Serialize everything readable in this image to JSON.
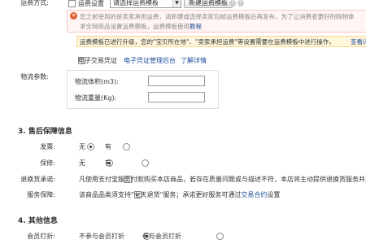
{
  "freight": {
    "method_label": "运费方式:",
    "option_label": "运费设置",
    "select_value": "请选择运费模板",
    "new_button": "新建运费模板",
    "warning_text1": "您之前使用的是卖家承担运费，请新建或选择卖家包邮运费模板后再发布。为了让消费者更好的购物体",
    "warning_text2": "求全网商品设置运费模板，运费模板使用",
    "warning_link": "教程",
    "info_text": "运费模板已进行升级，您的\"宝贝所在地\"、\"卖家承担运费\"等设置需要在运费模板中进行操作，",
    "info_link": "查看详"
  },
  "voucher": {
    "label": "电子交易凭证",
    "link1": "电子凭证管理后台",
    "link2": "了解详情"
  },
  "logistics": {
    "label": "物流参数:",
    "volume_label": "物流体积(m3):",
    "weight_label": "物流重量(Kg):",
    "volume_value": "",
    "weight_value": ""
  },
  "after_sales": {
    "title": "3. 售后保障信息",
    "invoice_label": "发票:",
    "warranty_label": "保修:",
    "yes": "有",
    "no": "无",
    "return_label": "退换货承诺:",
    "return_text": "凡使用支付宝服务付款购买本店商品，若存在质量问题或与描述不符，本店将主动提供退换货服务并承",
    "service_label": "服务保障:",
    "service_text": "该商品品类须支持\"七天退货\"服务；承诺更好服务可通过",
    "service_link": "交易合约",
    "service_suffix": "设置"
  },
  "other": {
    "title": "4. 其他信息",
    "member_label": "会员打折:",
    "opt_no": "不参与会员打折",
    "opt_yes": "参与会员打折"
  },
  "colors": {
    "warning_red": "#e35b2d",
    "link_blue": "#1e4e9c",
    "info_bg": "#fff6dc"
  }
}
